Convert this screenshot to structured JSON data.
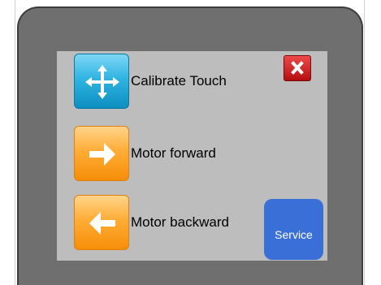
{
  "menu": {
    "items": [
      {
        "label": "Calibrate Touch",
        "icon": "move-arrows-icon"
      },
      {
        "label": "Motor forward",
        "icon": "arrow-right-icon"
      },
      {
        "label": "Motor backward",
        "icon": "arrow-left-icon"
      }
    ]
  },
  "close": {
    "icon": "close-icon"
  },
  "service": {
    "label": "Service"
  },
  "colors": {
    "bezel": "#6f6f6f",
    "screen": "#bdbdbd",
    "tile_blue": "#2fb4e2",
    "tile_orange": "#ffad36",
    "close_red": "#d42a2a",
    "service_blue": "#3a6fd8"
  }
}
